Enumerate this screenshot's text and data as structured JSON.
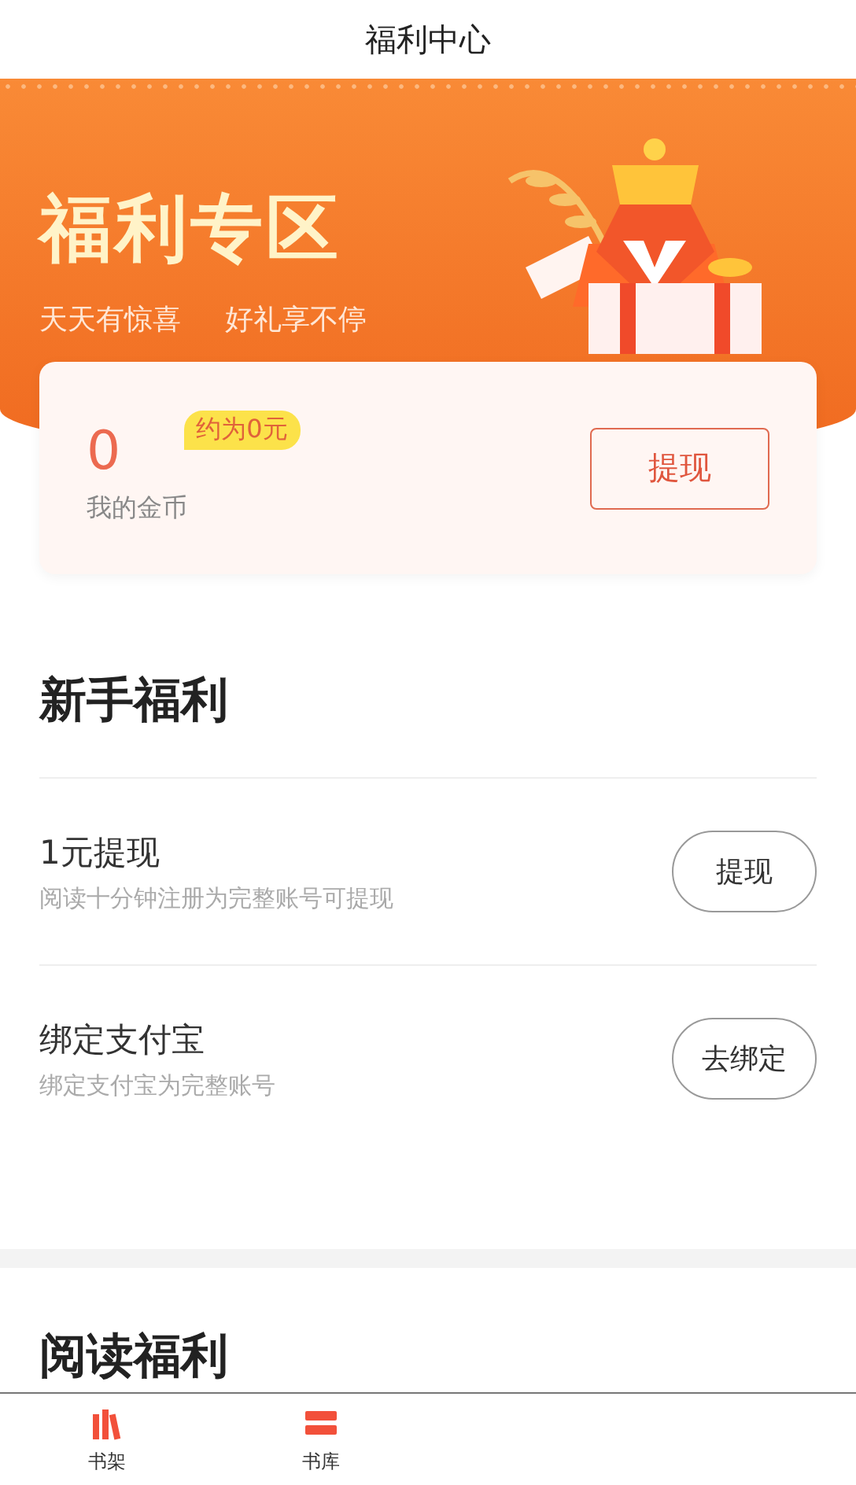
{
  "header": {
    "title": "福利中心"
  },
  "banner": {
    "title": "福利专区",
    "slogans": [
      "天天有惊喜",
      "好礼享不停"
    ]
  },
  "coins": {
    "amount": "0",
    "estimate": "约为0元",
    "label": "我的金币",
    "button": "提现"
  },
  "newbie": {
    "title": "新手福利",
    "tasks": [
      {
        "title": "1元提现",
        "desc": "阅读十分钟注册为完整账号可提现",
        "button": "提现"
      },
      {
        "title": "绑定支付宝",
        "desc": "绑定支付宝为完整账号",
        "button": "去绑定"
      }
    ]
  },
  "reading": {
    "title": "阅读福利"
  },
  "tab_bar": [
    {
      "label": "书架",
      "kind": "shelf"
    },
    {
      "label": "书库",
      "kind": "library"
    }
  ]
}
